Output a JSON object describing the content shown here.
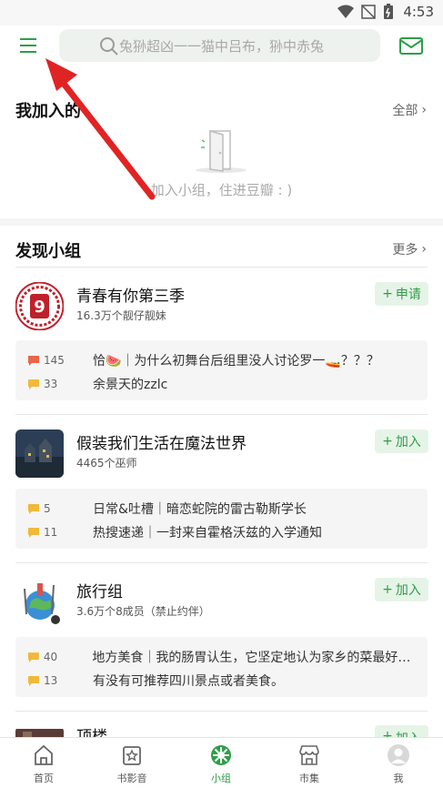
{
  "status_bar": {
    "time": "4:53"
  },
  "search": {
    "placeholder": "兔狲超凶一一猫中吕布，狲中赤兔"
  },
  "my_groups": {
    "title": "我加入的",
    "more": "全部",
    "empty_text": "加入小组，住进豆瓣 : )"
  },
  "discover": {
    "title": "发现小组",
    "more": "更多",
    "groups": [
      {
        "name": "青春有你第三季",
        "meta": "16.3万个靓仔靓妹",
        "action": "申请",
        "topics": [
          {
            "count": "145",
            "title": "恰🍉｜为什么初舞台后组里没人讨论罗一🚤？？？"
          },
          {
            "count": "33",
            "title": "余景天的zzlc"
          }
        ]
      },
      {
        "name": "假装我们生活在魔法世界",
        "meta": "4465个巫师",
        "action": "加入",
        "topics": [
          {
            "count": "5",
            "title": "日常&吐槽｜暗恋蛇院的雷古勒斯学长"
          },
          {
            "count": "11",
            "title": "热搜速递｜一封来自霍格沃兹的入学通知"
          }
        ]
      },
      {
        "name": "旅行组",
        "meta": "3.6万个8成员（禁止约伴）",
        "action": "加入",
        "topics": [
          {
            "count": "40",
            "title": "地方美食｜我的肠胃认生，它坚定地认为家乡的菜最好吃..."
          },
          {
            "count": "13",
            "title": "有没有可推荐四川景点或者美食。"
          }
        ]
      },
      {
        "name": "顶楼",
        "action": "加入"
      }
    ]
  },
  "bottom_nav": [
    {
      "label": "首页",
      "icon": "home-icon"
    },
    {
      "label": "书影音",
      "icon": "media-icon"
    },
    {
      "label": "小组",
      "icon": "group-icon",
      "active": true
    },
    {
      "label": "市集",
      "icon": "market-icon"
    },
    {
      "label": "我",
      "icon": "avatar-icon"
    }
  ],
  "colors": {
    "accent": "#2e9e48",
    "join_bg": "#e6f4e8",
    "hot_comment": "#e8674a",
    "comment": "#f0b93a",
    "annotation_arrow": "#e02424"
  }
}
